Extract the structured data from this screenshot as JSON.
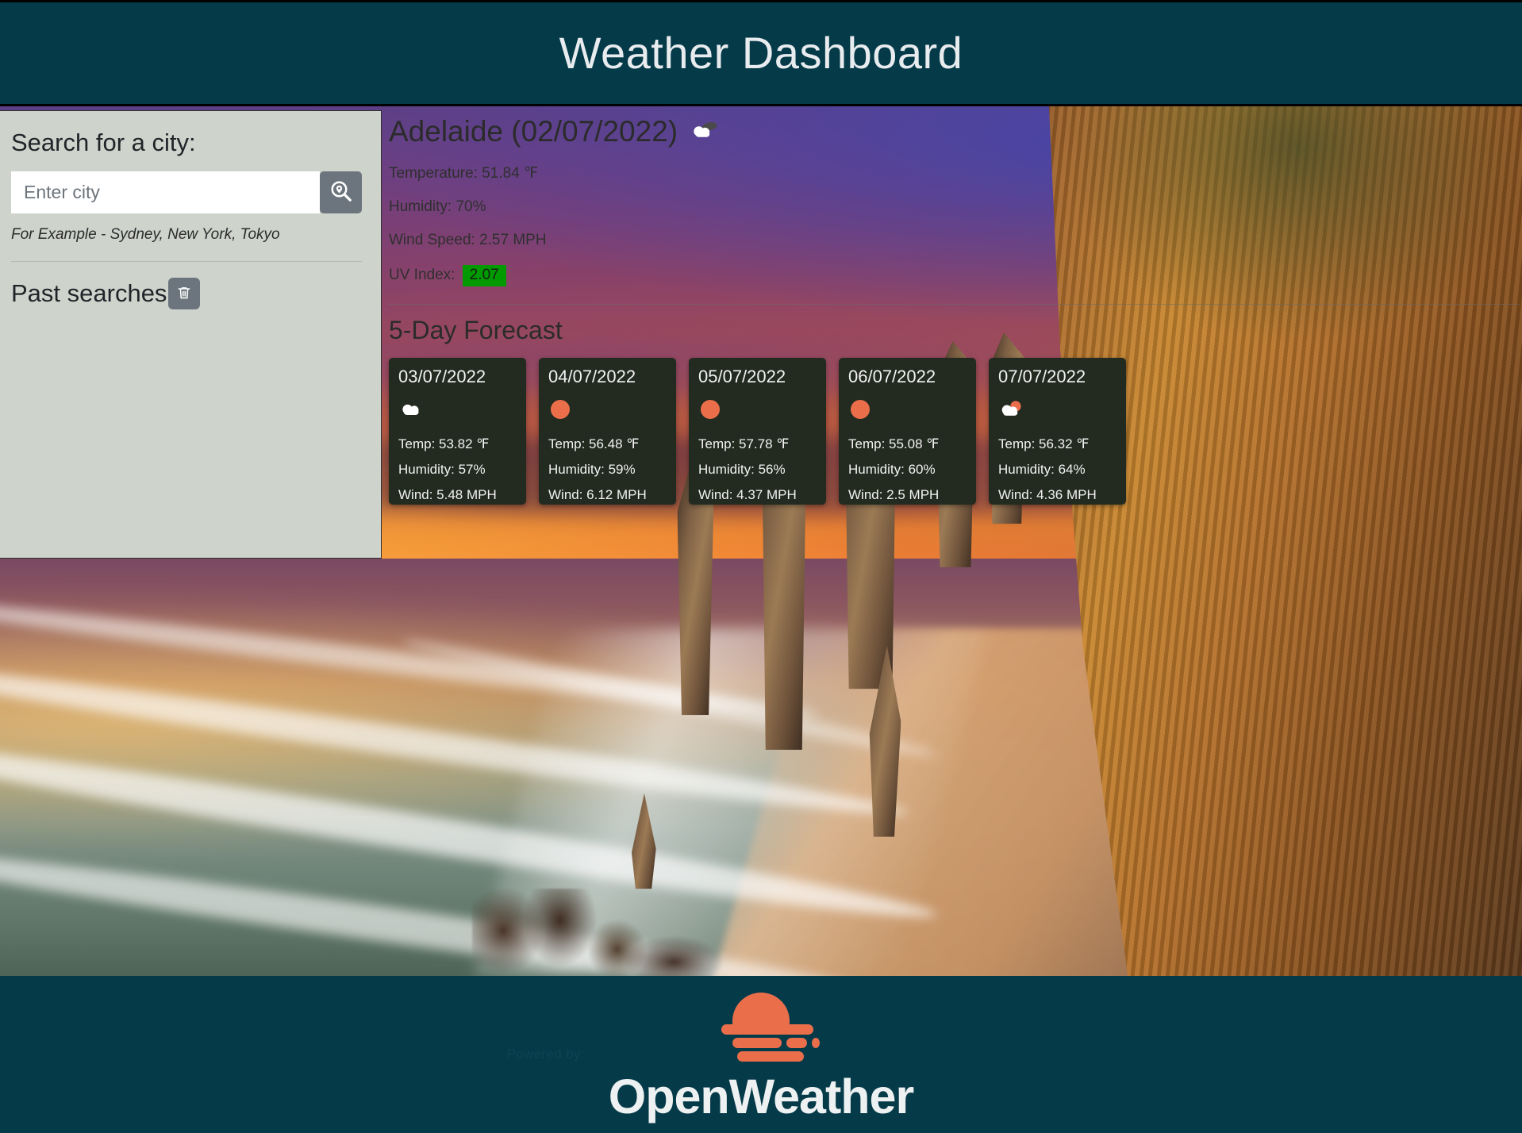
{
  "header": {
    "title": "Weather Dashboard"
  },
  "sidebar": {
    "search_label": "Search for a city:",
    "search_placeholder": "Enter city",
    "search_value": "",
    "search_icon": "search-location-icon",
    "hint": "For Example - Sydney, New York, Tokyo",
    "past_searches_label": "Past searches",
    "clear_icon": "trash-icon",
    "past_searches": []
  },
  "current": {
    "city_and_date": "Adelaide (02/07/2022)",
    "icon": "broken-clouds-icon",
    "temperature": "Temperature: 51.84 ℉",
    "humidity": "Humidity: 70%",
    "wind": "Wind Speed: 2.57 MPH",
    "uv_label": "UV Index:",
    "uv_value": "2.07",
    "uv_color": "#019a00"
  },
  "forecast": {
    "title": "5-Day Forecast",
    "cards": [
      {
        "date": "03/07/2022",
        "icon": "cloud-icon",
        "temp": "Temp: 53.82 ℉",
        "humidity": "Humidity: 57%",
        "wind": "Wind: 5.48 MPH"
      },
      {
        "date": "04/07/2022",
        "icon": "sun-icon",
        "temp": "Temp: 56.48 ℉",
        "humidity": "Humidity: 59%",
        "wind": "Wind: 6.12 MPH"
      },
      {
        "date": "05/07/2022",
        "icon": "sun-icon",
        "temp": "Temp: 57.78 ℉",
        "humidity": "Humidity: 56%",
        "wind": "Wind: 4.37 MPH"
      },
      {
        "date": "06/07/2022",
        "icon": "sun-icon",
        "temp": "Temp: 55.08 ℉",
        "humidity": "Humidity: 60%",
        "wind": "Wind: 2.5 MPH"
      },
      {
        "date": "07/07/2022",
        "icon": "sun-cloud-icon",
        "temp": "Temp: 56.32 ℉",
        "humidity": "Humidity: 64%",
        "wind": "Wind: 4.36 MPH"
      }
    ]
  },
  "footer": {
    "powered_by": "Powered by:",
    "brand": "OpenWeather",
    "logo_icon": "openweather-sun-icon",
    "brand_color": "#eb6e4b",
    "background_color": "#053b49"
  }
}
